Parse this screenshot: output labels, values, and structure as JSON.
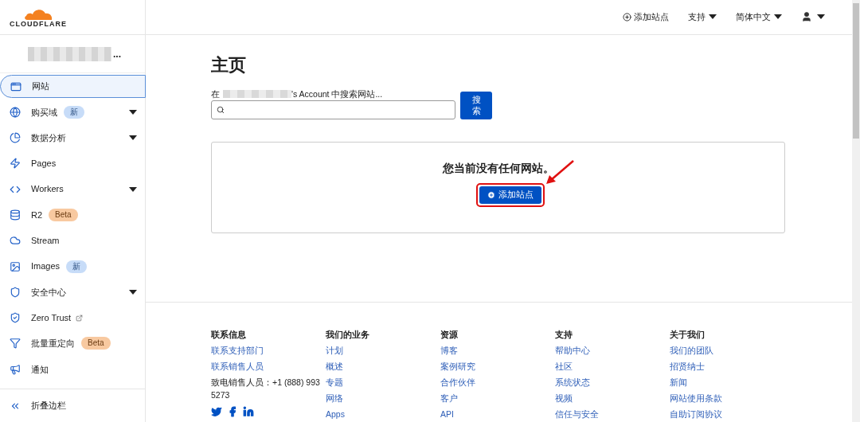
{
  "logo": {
    "text": "CLOUDFLARE"
  },
  "account": {
    "ellipsis": "..."
  },
  "sidebar": {
    "items": [
      {
        "label": "网站",
        "selected": true,
        "caret": false
      },
      {
        "label": "购买域",
        "selected": false,
        "caret": true,
        "badge": {
          "text": "新",
          "kind": "new"
        }
      },
      {
        "label": "数据分析",
        "selected": false,
        "caret": true
      },
      {
        "label": "Pages",
        "selected": false,
        "caret": false
      },
      {
        "label": "Workers",
        "selected": false,
        "caret": true
      },
      {
        "label": "R2",
        "selected": false,
        "caret": false,
        "badge": {
          "text": "Beta",
          "kind": "beta"
        }
      },
      {
        "label": "Stream",
        "selected": false,
        "caret": false
      },
      {
        "label": "Images",
        "selected": false,
        "caret": false,
        "badge": {
          "text": "新",
          "kind": "new"
        }
      },
      {
        "label": "安全中心",
        "selected": false,
        "caret": true
      },
      {
        "label": "Zero Trust",
        "selected": false,
        "caret": false,
        "external": true
      },
      {
        "label": "批量重定向",
        "selected": false,
        "caret": false,
        "badge": {
          "text": "Beta",
          "kind": "beta"
        }
      },
      {
        "label": "通知",
        "selected": false,
        "caret": false
      }
    ],
    "collapse": "折叠边栏"
  },
  "topbar": {
    "add_site": "添加站点",
    "support": "支持",
    "language": "简体中文"
  },
  "page": {
    "title": "主页",
    "search_prefix": "在",
    "search_suffix": "'s Account 中搜索网站...",
    "search_button": [
      "搜",
      "索"
    ],
    "empty_message": "您当前没有任何网站。",
    "add_site_button": "添加站点"
  },
  "footer": {
    "columns": [
      {
        "heading": "联系信息",
        "items": [
          {
            "text": "联系支持部门",
            "kind": "link"
          },
          {
            "text": "联系销售人员",
            "kind": "link"
          },
          {
            "text": "致电销售人员：+1 (888) 993 5273",
            "kind": "text"
          }
        ],
        "social": true
      },
      {
        "heading": "我们的业务",
        "items": [
          {
            "text": "计划",
            "kind": "link"
          },
          {
            "text": "概述",
            "kind": "link"
          },
          {
            "text": "专题",
            "kind": "link"
          },
          {
            "text": "网络",
            "kind": "link"
          },
          {
            "text": "Apps",
            "kind": "link"
          }
        ]
      },
      {
        "heading": "资源",
        "items": [
          {
            "text": "博客",
            "kind": "link"
          },
          {
            "text": "案例研究",
            "kind": "link"
          },
          {
            "text": "合作伙伴",
            "kind": "link"
          },
          {
            "text": "客户",
            "kind": "link"
          },
          {
            "text": "API",
            "kind": "link"
          }
        ]
      },
      {
        "heading": "支持",
        "items": [
          {
            "text": "帮助中心",
            "kind": "link"
          },
          {
            "text": "社区",
            "kind": "link"
          },
          {
            "text": "系统状态",
            "kind": "link"
          },
          {
            "text": "视频",
            "kind": "link"
          },
          {
            "text": "信任与安全",
            "kind": "link"
          }
        ]
      },
      {
        "heading": "关于我们",
        "items": [
          {
            "text": "我们的团队",
            "kind": "link"
          },
          {
            "text": "招贤纳士",
            "kind": "link"
          },
          {
            "text": "新闻",
            "kind": "link"
          },
          {
            "text": "网站使用条款",
            "kind": "link"
          },
          {
            "text": "自助订阅协议",
            "kind": "link"
          }
        ]
      }
    ]
  }
}
